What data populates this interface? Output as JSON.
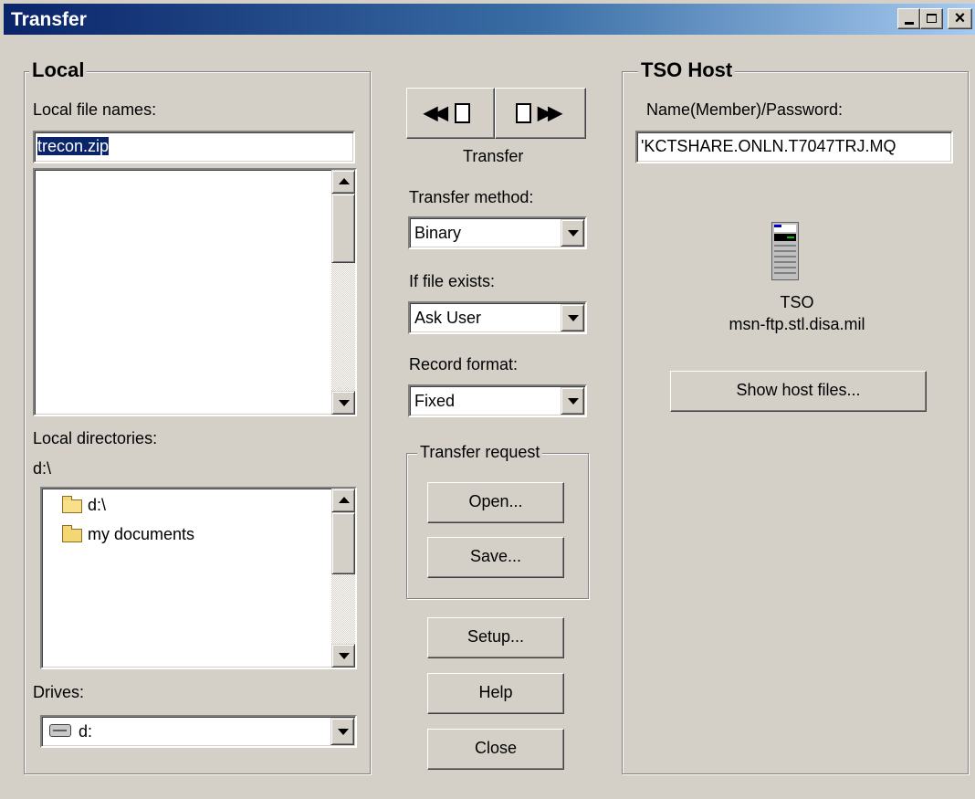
{
  "window": {
    "title": "Transfer"
  },
  "local": {
    "group_label": "Local",
    "file_names_label": "Local file names:",
    "file_name_value": "trecon.zip",
    "directories_label": "Local directories:",
    "current_dir": "d:\\",
    "tree": [
      {
        "label": "d:\\",
        "icon": "open-folder-icon"
      },
      {
        "label": "my documents",
        "icon": "folder-icon"
      }
    ],
    "drives_label": "Drives:",
    "drive_value": "d:"
  },
  "middle": {
    "transfer_label": "Transfer",
    "method_label": "Transfer method:",
    "method_value": "Binary",
    "exists_label": "If file exists:",
    "exists_value": "Ask User",
    "record_label": "Record format:",
    "record_value": "Fixed",
    "request_group_label": "Transfer request",
    "open_label": "Open...",
    "save_label": "Save...",
    "setup_label": "Setup...",
    "help_label": "Help",
    "close_label": "Close"
  },
  "host": {
    "group_label": "TSO Host",
    "name_label": "Name(Member)/Password:",
    "name_value": "'KCTSHARE.ONLN.T7047TRJ.MQ",
    "host_type": "TSO",
    "host_name": "msn-ftp.stl.disa.mil",
    "show_files_label": "Show host files..."
  },
  "colors": {
    "face": "#d4d0c8",
    "title_start": "#0a246a",
    "title_end": "#a6caf0",
    "selection": "#0a246a"
  }
}
